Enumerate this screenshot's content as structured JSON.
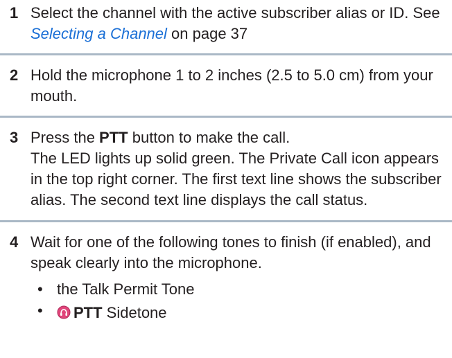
{
  "steps": [
    {
      "number": "1",
      "text_before": "Select the channel with the active subscriber alias or ID. See ",
      "link": "Selecting a Channel",
      "text_after": " on page 37"
    },
    {
      "number": "2",
      "text": "Hold the microphone 1 to 2 inches (2.5 to 5.0 cm) from your mouth."
    },
    {
      "number": "3",
      "line1_before": "Press the ",
      "line1_bold": "PTT",
      "line1_after": " button to make the call.",
      "description": "The LED lights up solid green. The Private Call icon appears in the top right corner. The first text line shows the subscriber alias. The second text line displays the call status."
    },
    {
      "number": "4",
      "text": "Wait for one of the following tones to finish (if enabled), and speak clearly into the microphone.",
      "bullets": [
        {
          "marker": "•",
          "text": "the Talk Permit Tone"
        },
        {
          "marker": "•",
          "icon": "ptt-sidetone-icon",
          "bold": "PTT",
          "text_after": " Sidetone"
        }
      ]
    }
  ],
  "colors": {
    "link": "#1a6fd6",
    "divider": "#aab8c6",
    "icon": "#e0457a"
  }
}
